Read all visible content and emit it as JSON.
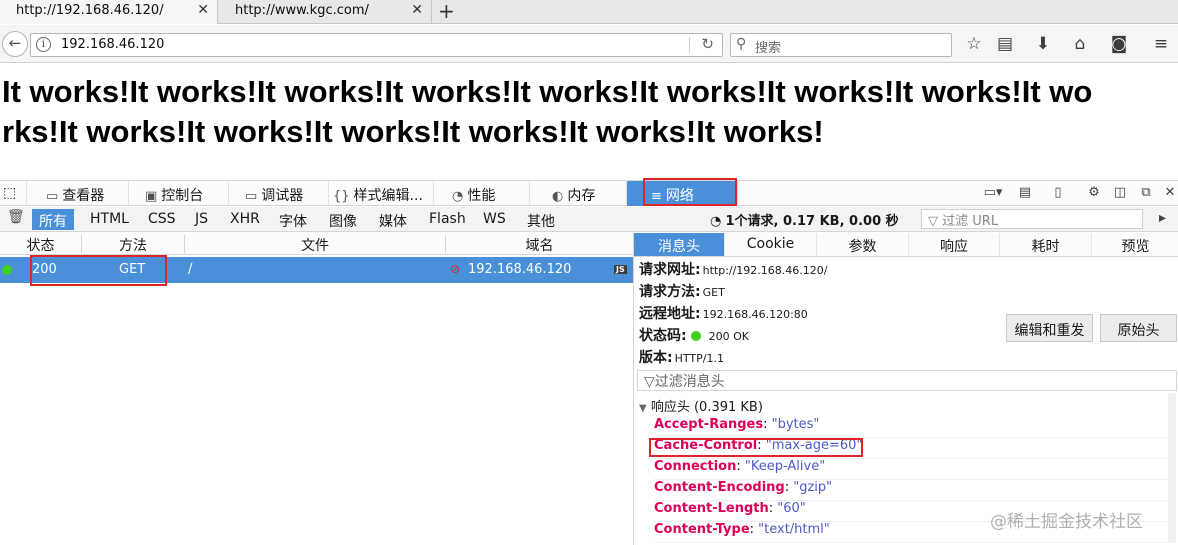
{
  "browser": {
    "tabs": [
      {
        "label": "http://192.168.46.120/"
      },
      {
        "label": "http://www.kgc.com/"
      }
    ],
    "url": "192.168.46.120",
    "search_placeholder": "搜索"
  },
  "page": {
    "text": "It works!It works!It works!It works!It works!It works!It works!It works!It works!It works!It works!It works!It works!It works!It works!"
  },
  "devtools": {
    "tools": [
      "查看器",
      "控制台",
      "调试器",
      "样式编辑...",
      "性能",
      "内存",
      "网络"
    ],
    "filters": [
      "所有",
      "HTML",
      "CSS",
      "JS",
      "XHR",
      "字体",
      "图像",
      "媒体",
      "Flash",
      "WS",
      "其他"
    ],
    "summary": "1个请求, 0.17 KB, 0.00 秒",
    "filter_url_placeholder": "过滤 URL",
    "columns": [
      "状态",
      "方法",
      "文件",
      "域名"
    ],
    "request": {
      "status": "200",
      "method": "GET",
      "file": "/",
      "domain": "192.168.46.120",
      "type_badge": "JS"
    },
    "sidebar": {
      "tabs": [
        "消息头",
        "Cookie",
        "参数",
        "响应",
        "耗时",
        "预览"
      ],
      "request_url_label": "请求网址:",
      "request_url": "http://192.168.46.120/",
      "request_method_label": "请求方法:",
      "request_method": "GET",
      "remote_address_label": "远程地址:",
      "remote_address": "192.168.46.120:80",
      "status_code_label": "状态码:",
      "status_code": "200  OK",
      "version_label": "版本:",
      "version": "HTTP/1.1",
      "edit_resend": "编辑和重发",
      "raw_headers": "原始头",
      "filter_headers_placeholder": "过滤消息头",
      "response_headers_title": "响应头 (0.391 KB)",
      "response_headers": [
        {
          "name": "Accept-Ranges",
          "value": "\"bytes\""
        },
        {
          "name": "Cache-Control",
          "value": "\"max-age=60\""
        },
        {
          "name": "Connection",
          "value": "\"Keep-Alive\""
        },
        {
          "name": "Content-Encoding",
          "value": "\"gzip\""
        },
        {
          "name": "Content-Length",
          "value": "\"60\""
        },
        {
          "name": "Content-Type",
          "value": "\"text/html\""
        }
      ]
    }
  },
  "watermark": "@稀土掘金技术社区",
  "colors": {
    "selection_blue": "#4a90d9",
    "highlight_red": "#e0242c",
    "header_name": "#dd0058",
    "header_value": "#4f5ac5",
    "status_green": "#3fd019"
  }
}
